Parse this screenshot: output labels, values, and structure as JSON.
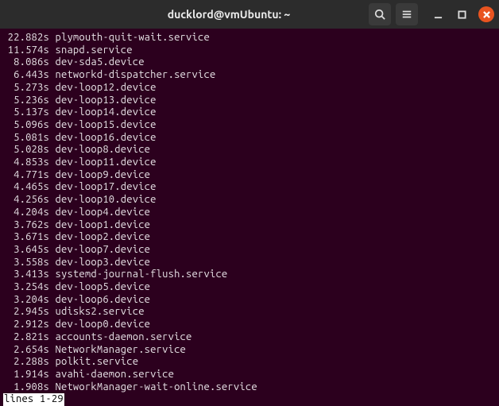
{
  "window": {
    "title": "ducklord@vmUbuntu: ~"
  },
  "terminal": {
    "lines": [
      {
        "time": "22.882s",
        "name": "plymouth-quit-wait.service"
      },
      {
        "time": "11.574s",
        "name": "snapd.service"
      },
      {
        "time": "8.086s",
        "name": "dev-sda5.device"
      },
      {
        "time": "6.443s",
        "name": "networkd-dispatcher.service"
      },
      {
        "time": "5.273s",
        "name": "dev-loop12.device"
      },
      {
        "time": "5.236s",
        "name": "dev-loop13.device"
      },
      {
        "time": "5.137s",
        "name": "dev-loop14.device"
      },
      {
        "time": "5.096s",
        "name": "dev-loop15.device"
      },
      {
        "time": "5.081s",
        "name": "dev-loop16.device"
      },
      {
        "time": "5.028s",
        "name": "dev-loop8.device"
      },
      {
        "time": "4.853s",
        "name": "dev-loop11.device"
      },
      {
        "time": "4.771s",
        "name": "dev-loop9.device"
      },
      {
        "time": "4.465s",
        "name": "dev-loop17.device"
      },
      {
        "time": "4.256s",
        "name": "dev-loop10.device"
      },
      {
        "time": "4.204s",
        "name": "dev-loop4.device"
      },
      {
        "time": "3.762s",
        "name": "dev-loop1.device"
      },
      {
        "time": "3.671s",
        "name": "dev-loop2.device"
      },
      {
        "time": "3.645s",
        "name": "dev-loop7.device"
      },
      {
        "time": "3.558s",
        "name": "dev-loop3.device"
      },
      {
        "time": "3.413s",
        "name": "systemd-journal-flush.service"
      },
      {
        "time": "3.254s",
        "name": "dev-loop5.device"
      },
      {
        "time": "3.204s",
        "name": "dev-loop6.device"
      },
      {
        "time": "2.945s",
        "name": "udisks2.service"
      },
      {
        "time": "2.912s",
        "name": "dev-loop0.device"
      },
      {
        "time": "2.821s",
        "name": "accounts-daemon.service"
      },
      {
        "time": "2.654s",
        "name": "NetworkManager.service"
      },
      {
        "time": "2.288s",
        "name": "polkit.service"
      },
      {
        "time": "1.914s",
        "name": "avahi-daemon.service"
      },
      {
        "time": "1.908s",
        "name": "NetworkManager-wait-online.service"
      }
    ],
    "status": "lines 1-29"
  }
}
